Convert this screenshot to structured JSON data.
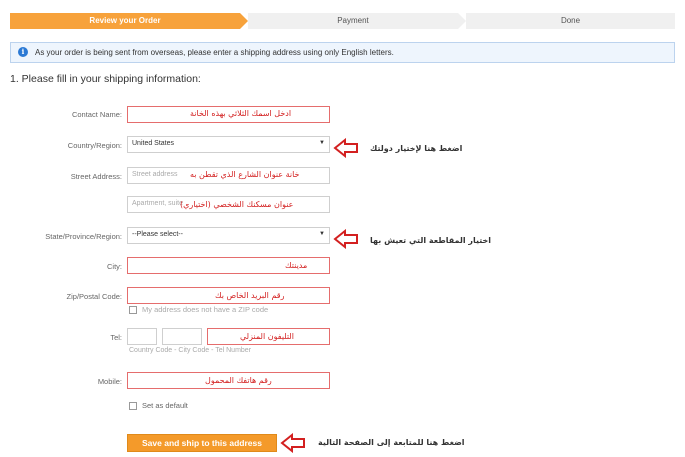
{
  "steps": [
    "Review your Order",
    "Payment",
    "Done"
  ],
  "notice": "As your order is being sent from overseas, please enter a shipping address using only English letters.",
  "heading": "1. Please fill in your shipping information:",
  "form": {
    "contact_label": "Contact Name:",
    "contact_annotation": "ادخل اسمك الثلاثي بهذه الخانة",
    "country_label": "Country/Region:",
    "country_value": "United States",
    "country_annotation": "اضغط هنا لإختيار دولتك",
    "street_label": "Street Address:",
    "street_placeholder": "Street address",
    "street_annotation": "خانة عنوان الشارع الذي تقطن به",
    "apartment_placeholder": "Apartment, suite",
    "apartment_annotation": "عنوان مسكنك الشخصي (اختياري)",
    "state_label": "State/Province/Region:",
    "state_value": "--Please select--",
    "state_annotation": "اختيار المقاطعة التي تعيش بها",
    "city_label": "City:",
    "city_annotation": "مدينتك",
    "zip_label": "Zip/Postal Code:",
    "zip_annotation": "رقم البريد الخاص بك",
    "no_zip_label": "My address does not have a ZIP code",
    "tel_label": "Tel:",
    "tel_annotation": "التليفون المنزلي",
    "tel_hint": "Country Code - City Code - Tel Number",
    "mobile_label": "Mobile:",
    "mobile_annotation": "رقم هاتفك المحمول",
    "default_label": "Set as default",
    "submit_label": "Save and ship to this address",
    "submit_annotation": "اضغط هنا للمتابعة إلى الصفحة التالية"
  },
  "colors": {
    "accent": "#f7a23b",
    "annotation": "#d32020"
  }
}
